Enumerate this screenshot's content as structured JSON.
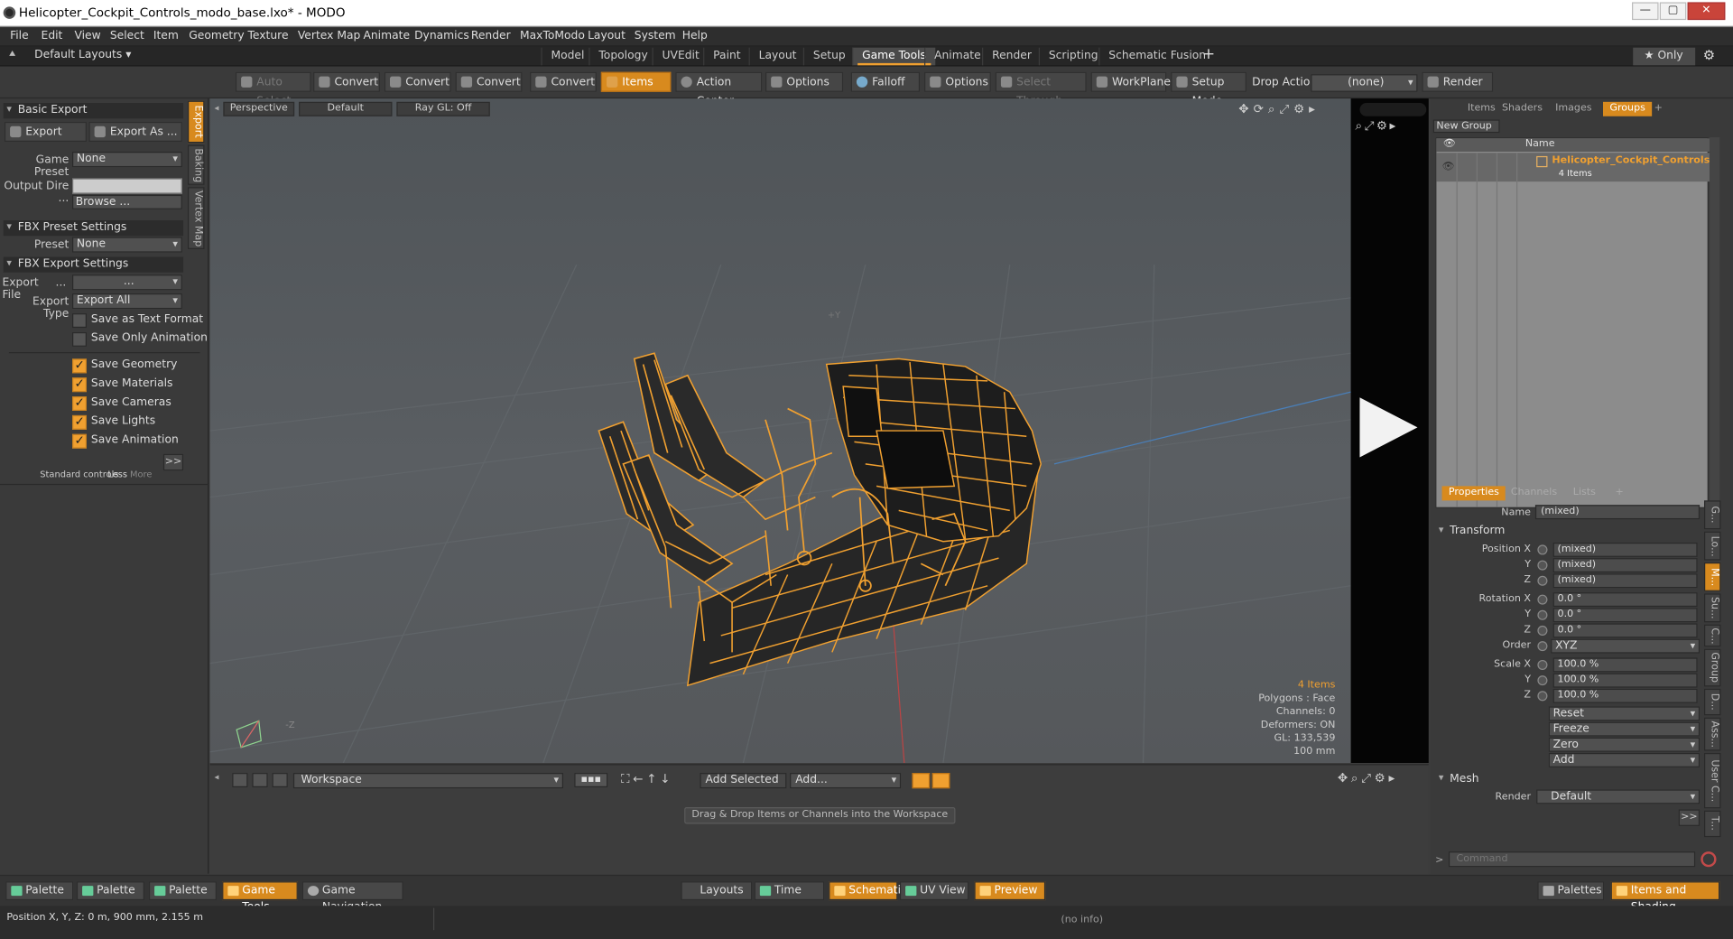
{
  "window": {
    "title": "Helicopter_Cockpit_Controls_modo_base.lxo* - MODO",
    "minimize": "—",
    "maximize": "▢",
    "close": "✕"
  },
  "menu": [
    "File",
    "Edit",
    "View",
    "Select",
    "Item",
    "Geometry",
    "Texture",
    "Vertex Map",
    "Animate",
    "Dynamics",
    "Render",
    "MaxToModo",
    "Layout",
    "System",
    "Help"
  ],
  "layout_selector": "Default Layouts ▾",
  "layout_tabs": [
    "Model",
    "Topology",
    "UVEdit",
    "Paint",
    "Layout",
    "Setup",
    "Game Tools",
    "Animate",
    "Render",
    "Scripting",
    "Schematic Fusion"
  ],
  "active_layout_tab": "Game Tools",
  "add_tab": "+",
  "only_button": "★  Only",
  "toolbar": {
    "auto_select": "Auto Select",
    "convert1": "Convert",
    "convert2": "Convert",
    "convert3": "Convert",
    "convert4": "Convert",
    "items": "Items",
    "action_center": "Action Center",
    "options1": "Options",
    "falloff": "Falloff",
    "options2": "Options",
    "select_through": "Select Through",
    "workplane": "WorkPlane",
    "setup_mode": "Setup Mode",
    "drop_action": "Drop Action",
    "drop_value": "(none)",
    "render": "Render ..."
  },
  "left": {
    "basic_export": "Basic Export",
    "export": "Export",
    "export_as": "Export As ...",
    "game_preset_label": "Game Preset",
    "game_preset_value": "None",
    "output_dir_label": "Output Dire ...",
    "browse": "Browse ...",
    "fbx_preset": "FBX Preset Settings",
    "preset_label": "Preset",
    "preset_value": "None",
    "fbx_export": "FBX Export Settings",
    "export_file_label": "Export File",
    "export_file_dots": "...",
    "export_file_value": "...",
    "export_type_label": "Export Type",
    "export_type_value": "Export All",
    "checks": [
      {
        "label": "Save as Text Format",
        "on": false
      },
      {
        "label": "Save Only Animation",
        "on": false
      },
      {
        "label": "Save Geometry",
        "on": true
      },
      {
        "label": "Save Materials",
        "on": true
      },
      {
        "label": "Save Cameras",
        "on": true
      },
      {
        "label": "Save Lights",
        "on": true
      },
      {
        "label": "Save Animation",
        "on": true
      }
    ],
    "more_btn": ">>",
    "std_controls": "Standard controls",
    "less": "Less",
    "more": "More",
    "side_tabs": [
      "Export",
      "Baking",
      "Vertex Map"
    ]
  },
  "viewport": {
    "view": "Perspective",
    "shading": "Default",
    "raygl": "Ray GL: Off",
    "info": {
      "items": "4 Items",
      "polygons": "Polygons : Face",
      "channels": "Channels: 0",
      "deformers": "Deformers: ON",
      "gl": "GL: 133,539",
      "scale": "100 mm"
    },
    "axis_label": "+Y",
    "axis_label2": "-Z"
  },
  "items_panel": {
    "tabs": [
      "Items",
      "Shaders",
      "Images",
      "Groups"
    ],
    "active_tab": "Groups",
    "add": "+",
    "new_group": "New Group",
    "col_name": "Name",
    "group_name": "Helicopter_Cockpit_Controls",
    "group_count": "4 Items"
  },
  "properties": {
    "tabs": [
      "Properties",
      "Channels",
      "Lists"
    ],
    "active_tab": "Properties",
    "add": "+",
    "name_label": "Name",
    "name_value": "(mixed)",
    "transform": "Transform",
    "position_x_label": "Position X",
    "rotation_x_label": "Rotation X",
    "scale_x_label": "Scale X",
    "y_label": "Y",
    "z_label": "Z",
    "position": [
      "(mixed)",
      "(mixed)",
      "(mixed)"
    ],
    "rotation": [
      "0.0 °",
      "0.0 °",
      "0.0 °"
    ],
    "order_label": "Order",
    "order_value": "XYZ",
    "scale": [
      "100.0 %",
      "100.0 %",
      "100.0 %"
    ],
    "actions": [
      "Reset",
      "Freeze",
      "Zero",
      "Add"
    ],
    "mesh": "Mesh",
    "render_label": "Render",
    "render_value": "Default",
    "more": ">>",
    "command_placeholder": "Command",
    "side_tabs": [
      "G...",
      "Lo...",
      "M...",
      "Su...",
      "C...",
      "Group",
      "D...",
      "Ass...",
      "User C...",
      "T..."
    ]
  },
  "workspace": {
    "dropdown": "Workspace",
    "add_selected": "Add Selected",
    "add": "Add...",
    "hint": "Drag & Drop Items or Channels into the Workspace"
  },
  "bottom_bar": {
    "palette1": "Palette",
    "palette2": "Palette",
    "palette3": "Palette",
    "game_tools": "Game Tools",
    "game_navigation": "Game Navigation",
    "layouts": "Layouts",
    "time": "Time",
    "schematic": "Schematic",
    "uv_view": "UV View",
    "preview": "Preview",
    "palettes": "Palettes",
    "items_shading": "Items and Shading"
  },
  "status": {
    "position": "Position X, Y, Z:   0 m, 900 mm, 2.155 m",
    "info": "(no info)"
  },
  "colors": {
    "accent": "#f0a030",
    "wire": "#f0a030"
  }
}
